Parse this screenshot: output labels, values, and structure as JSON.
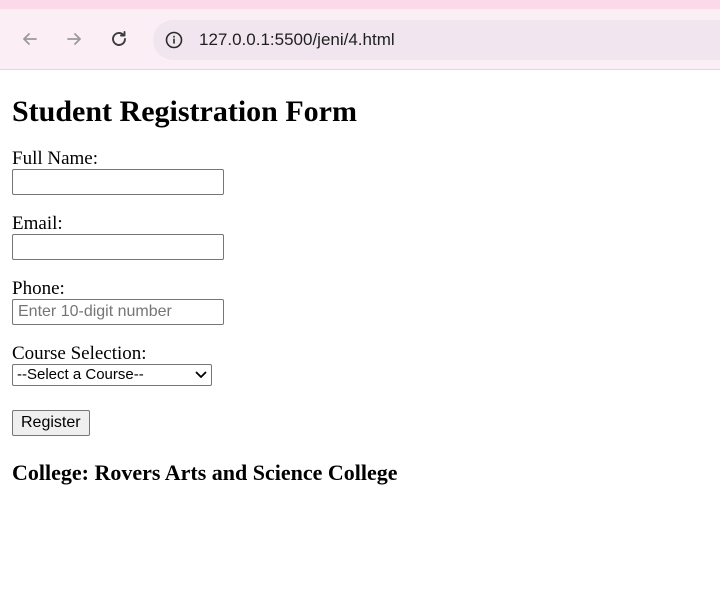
{
  "browser": {
    "url": "127.0.0.1:5500/jeni/4.html",
    "icons": {
      "back": "arrow-left-icon",
      "forward": "arrow-right-icon",
      "reload": "reload-icon",
      "info": "info-icon"
    }
  },
  "form": {
    "title": "Student Registration Form",
    "full_name_label": "Full Name:",
    "full_name_value": "",
    "email_label": "Email:",
    "email_value": "",
    "phone_label": "Phone:",
    "phone_placeholder": "Enter 10-digit number",
    "course_label": "Course Selection:",
    "course_selected": "--Select a Course--",
    "register_label": "Register"
  },
  "footer": {
    "college": "College: Rovers Arts and Science College"
  }
}
